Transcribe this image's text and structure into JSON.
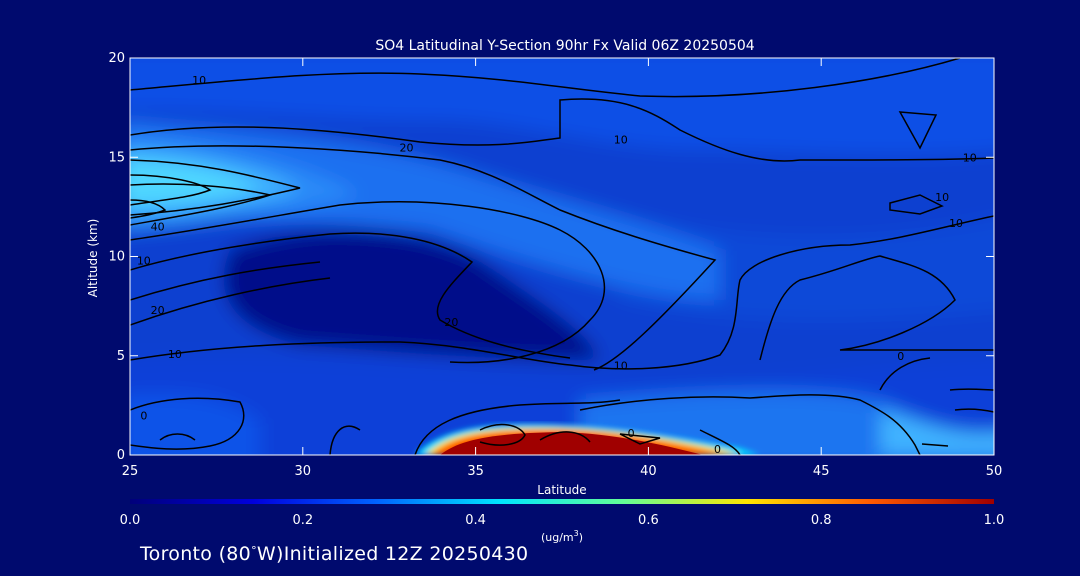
{
  "chart_data": {
    "type": "heatmap",
    "title": "SO4 Latitudinal Y-Section 90hr  Fx Valid 06Z 20250504",
    "xlabel": "Latitude",
    "ylabel": "Altitude (km)",
    "xlim": [
      25,
      50
    ],
    "ylim": [
      0,
      20
    ],
    "x_ticks": [
      "25",
      "30",
      "35",
      "40",
      "45",
      "50"
    ],
    "y_ticks": [
      "0",
      "5",
      "10",
      "15",
      "20"
    ],
    "colorbar": {
      "label": "(ug/m",
      "label_sup": "3",
      "label_close": ")",
      "ticks": [
        "0.0",
        "0.2",
        "0.4",
        "0.6",
        "0.8",
        "1.0"
      ],
      "range": [
        0,
        1
      ],
      "colors": [
        "#00007a",
        "#0000dc",
        "#0064ff",
        "#00e6ff",
        "#64ff96",
        "#ffe600",
        "#ff5a00",
        "#a00000"
      ]
    },
    "field_highlights": [
      {
        "name": "upper tropospheric maximum",
        "lat": 27,
        "alt_km": 14,
        "value": 0.35
      },
      {
        "name": "surface maximum",
        "lat_range": [
          34,
          41
        ],
        "alt_km_range": [
          0.3,
          1.6
        ],
        "value": 1.0
      },
      {
        "name": "clean middle troposphere",
        "lat": 33,
        "alt_km": 9,
        "value": 0.03
      }
    ],
    "contour_labels": [
      {
        "text": "10",
        "lat": 27,
        "alt_km": 18.9
      },
      {
        "text": "20",
        "lat": 33,
        "alt_km": 15.5
      },
      {
        "text": "10",
        "lat": 39.2,
        "alt_km": 15.9
      },
      {
        "text": "10",
        "lat": 49.3,
        "alt_km": 15
      },
      {
        "text": "10",
        "lat": 48.5,
        "alt_km": 13
      },
      {
        "text": "10",
        "lat": 48.9,
        "alt_km": 11.7
      },
      {
        "text": "40",
        "lat": 25.8,
        "alt_km": 11.5
      },
      {
        "text": "10",
        "lat": 25.4,
        "alt_km": 9.8
      },
      {
        "text": "20",
        "lat": 25.8,
        "alt_km": 7.3
      },
      {
        "text": "20",
        "lat": 34.3,
        "alt_km": 6.7
      },
      {
        "text": "10",
        "lat": 26.3,
        "alt_km": 5.1
      },
      {
        "text": "10",
        "lat": 39.2,
        "alt_km": 4.5
      },
      {
        "text": "0",
        "lat": 25.4,
        "alt_km": 2
      },
      {
        "text": "0",
        "lat": 39.5,
        "alt_km": 1.1
      },
      {
        "text": "0",
        "lat": 42,
        "alt_km": 0.3
      },
      {
        "text": "0",
        "lat": 47.3,
        "alt_km": 5
      }
    ]
  },
  "footer": {
    "pre": "Toronto (80",
    "degree": "°",
    "post": "W)Initialized 12Z 20250430"
  }
}
